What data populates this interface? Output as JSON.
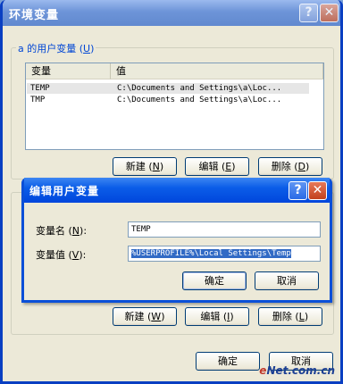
{
  "outer_window": {
    "title": "环境变量",
    "help_button": "?",
    "close_button": "✕",
    "user_vars_group": {
      "label_prefix": "a 的用户变量 (",
      "label_hotkey": "U",
      "label_suffix": ")",
      "columns": [
        "变量",
        "值"
      ],
      "rows": [
        {
          "name": "TEMP",
          "value": "C:\\Documents and Settings\\a\\Loc..."
        },
        {
          "name": "TMP",
          "value": "C:\\Documents and Settings\\a\\Loc..."
        }
      ],
      "buttons": {
        "new": {
          "label": "新建 (",
          "hotkey": "N",
          "suffix": ")"
        },
        "edit": {
          "label": "编辑 (",
          "hotkey": "E",
          "suffix": ")"
        },
        "delete": {
          "label": "删除 (",
          "hotkey": "D",
          "suffix": ")"
        }
      }
    },
    "system_vars_group": {
      "buttons": {
        "new": {
          "label": "新建 (",
          "hotkey": "W",
          "suffix": ")"
        },
        "edit": {
          "label": "编辑 (",
          "hotkey": "I",
          "suffix": ")"
        },
        "delete": {
          "label": "删除 (",
          "hotkey": "L",
          "suffix": ")"
        }
      }
    },
    "ok_button": "确定",
    "cancel_button": "取消"
  },
  "edit_dialog": {
    "title": "编辑用户变量",
    "help_button": "?",
    "close_button": "✕",
    "name_label": {
      "text": "变量名 (",
      "hotkey": "N",
      "suffix": "):"
    },
    "value_label": {
      "text": "变量值 (",
      "hotkey": "V",
      "suffix": "):"
    },
    "name_value": "TEMP",
    "value_value": "%USERPROFILE%\\Local Settings\\Temp",
    "ok_button": "确定",
    "cancel_button": "取消"
  },
  "watermark": {
    "part1": "e",
    "part2": "Net.com.cn"
  },
  "colors": {
    "title_blue": "#0a4fd8",
    "selection": "#316ac5",
    "group_label": "#0046d5"
  }
}
